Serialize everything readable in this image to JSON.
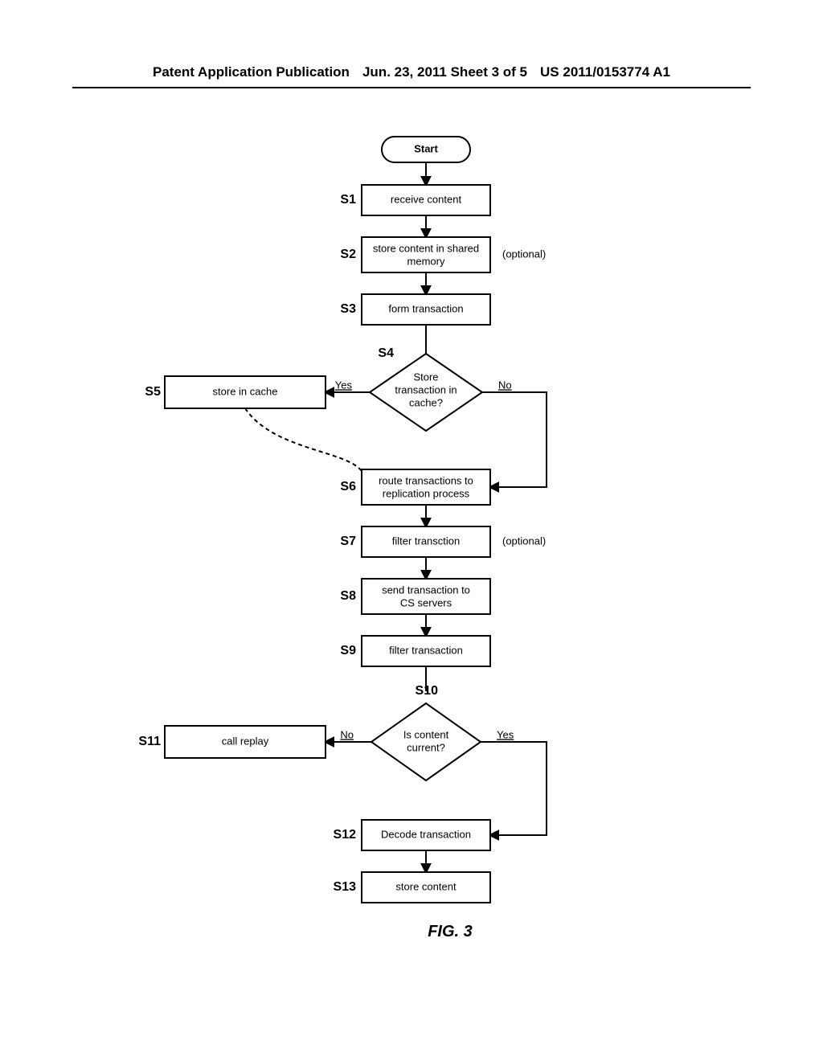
{
  "header": {
    "left": "Patent Application Publication",
    "center": "Jun. 23, 2011  Sheet 3 of 5",
    "right": "US 2011/0153774 A1"
  },
  "figure_caption": "FIG. 3",
  "chart_data": {
    "type": "flowchart",
    "start": "Start",
    "steps": [
      {
        "id": "S1",
        "text": "receive content",
        "shape": "process"
      },
      {
        "id": "S2",
        "text": "store content in shared memory",
        "shape": "process",
        "annotation": "(optional)"
      },
      {
        "id": "S3",
        "text": "form transaction",
        "shape": "process"
      },
      {
        "id": "S4",
        "text": "Store transaction in cache?",
        "shape": "decision",
        "yes_to": "S5",
        "no_to": "S6"
      },
      {
        "id": "S5",
        "text": "store in cache",
        "shape": "process",
        "next": "S6"
      },
      {
        "id": "S6",
        "text": "route transactions to replication process",
        "shape": "process"
      },
      {
        "id": "S7",
        "text": "filter transction",
        "shape": "process",
        "annotation": "(optional)"
      },
      {
        "id": "S8",
        "text": "send transaction to CS servers",
        "shape": "process"
      },
      {
        "id": "S9",
        "text": "filter transaction",
        "shape": "process"
      },
      {
        "id": "S10",
        "text": "Is content current?",
        "shape": "decision",
        "no_to": "S11",
        "yes_to": "S12"
      },
      {
        "id": "S11",
        "text": "call replay",
        "shape": "process",
        "next": "S12"
      },
      {
        "id": "S12",
        "text": "Decode transaction",
        "shape": "process"
      },
      {
        "id": "S13",
        "text": "store content",
        "shape": "process"
      }
    ],
    "labels": {
      "yes": "Yes",
      "no": "No"
    }
  }
}
